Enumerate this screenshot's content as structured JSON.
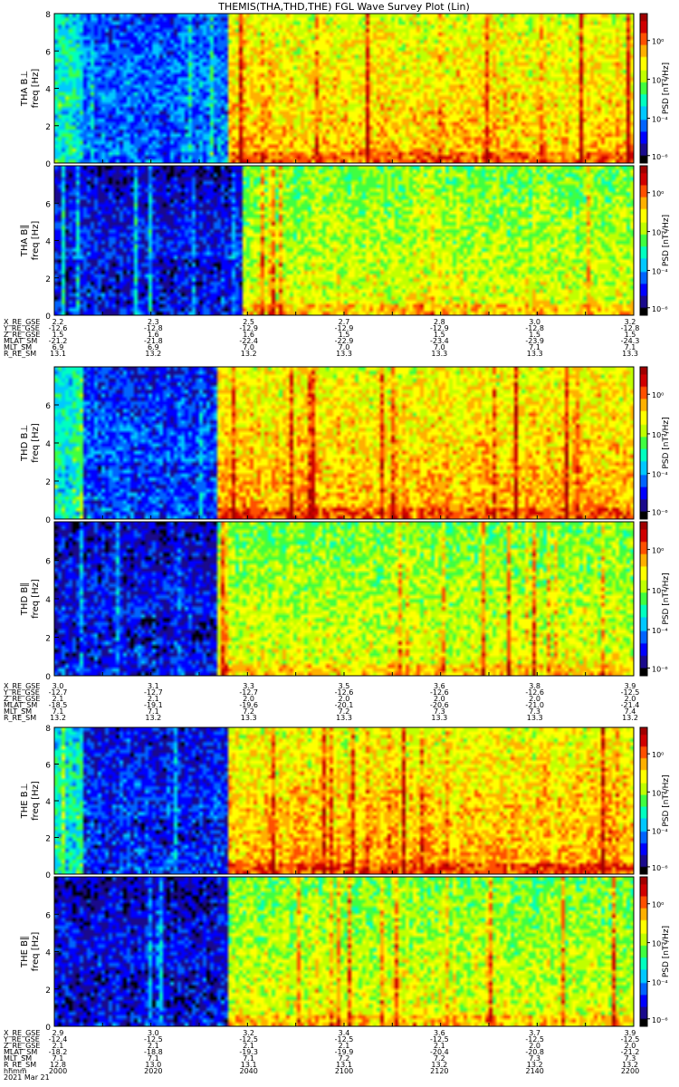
{
  "title": "THEMIS(THA,THD,THE) FGL Wave Survey Plot (Lin)",
  "colors": {
    "colormap": [
      "#000000",
      "#1a0a8c",
      "#0000ff",
      "#0064ff",
      "#00c8ff",
      "#00ffc0",
      "#40ff40",
      "#c0ff00",
      "#ffff00",
      "#ffb000",
      "#ff5000",
      "#d00000",
      "#a00000"
    ]
  },
  "chart_data": [
    {
      "type": "heatmap",
      "panel": "tha-bl",
      "ylabel_probe": "THA B⊥",
      "ylabel_freq": "freq [Hz]",
      "ylim": [
        0,
        8
      ],
      "yticks": [
        "0",
        "2",
        "4",
        "6",
        "8"
      ],
      "zlabel": "PSD [nT²/Hz]",
      "zticks": [
        "10⁰",
        "10⁻²",
        "10⁻⁴",
        "10⁻⁶"
      ],
      "baseline": 0.42,
      "quiet": [
        [
          0.05,
          0.3,
          0.15
        ]
      ],
      "active_level": 0.68,
      "active_from": 0.3
    },
    {
      "type": "heatmap",
      "panel": "tha-bpar",
      "ylabel_probe": "THA B∥",
      "ylabel_freq": "freq [Hz]",
      "ylim": [
        0,
        8
      ],
      "yticks": [
        "0",
        "2",
        "4",
        "6"
      ],
      "zlabel": "PSD [nT²/Hz]",
      "zticks": [
        "10⁰",
        "10⁻²",
        "10⁻⁴",
        "10⁻⁶"
      ],
      "baseline": 0.42,
      "quiet": [
        [
          0.0,
          0.32,
          0.25
        ]
      ],
      "active_level": 0.58,
      "active_from": 0.32
    },
    {
      "type": "heatmap",
      "panel": "thd-bl",
      "ylabel_probe": "THD B⊥",
      "ylabel_freq": "freq [Hz]",
      "ylim": [
        0,
        8
      ],
      "yticks": [
        "0",
        "2",
        "4",
        "6"
      ],
      "zlabel": "PSD [nT²/Hz]",
      "zticks": [
        "10⁰",
        "10⁻²",
        "10⁻⁴",
        "10⁻⁶"
      ],
      "baseline": 0.42,
      "quiet": [
        [
          0.05,
          0.28,
          0.18
        ]
      ],
      "active_level": 0.7,
      "active_from": 0.28
    },
    {
      "type": "heatmap",
      "panel": "thd-bpar",
      "ylabel_probe": "THD B∥",
      "ylabel_freq": "freq [Hz]",
      "ylim": [
        0,
        8
      ],
      "yticks": [
        "0",
        "2",
        "4",
        "6"
      ],
      "zlabel": "PSD [nT²/Hz]",
      "zticks": [
        "10⁰",
        "10⁻²",
        "10⁻⁴",
        "10⁻⁶"
      ],
      "baseline": 0.42,
      "quiet": [
        [
          0.0,
          0.28,
          0.25
        ]
      ],
      "active_level": 0.58,
      "active_from": 0.28
    },
    {
      "type": "heatmap",
      "panel": "the-bl",
      "ylabel_probe": "THE B⊥",
      "ylabel_freq": "freq [Hz]",
      "ylim": [
        0,
        8
      ],
      "yticks": [
        "0",
        "2",
        "4",
        "6",
        "8"
      ],
      "zlabel": "PSD [nT²/Hz]",
      "zticks": [
        "10⁰",
        "10⁻²",
        "10⁻⁴",
        "10⁻⁶"
      ],
      "baseline": 0.42,
      "quiet": [
        [
          0.05,
          0.3,
          0.22
        ]
      ],
      "active_level": 0.7,
      "active_from": 0.3
    },
    {
      "type": "heatmap",
      "panel": "the-bpar",
      "ylabel_probe": "THE B∥",
      "ylabel_freq": "freq [Hz]",
      "ylim": [
        0,
        8
      ],
      "yticks": [
        "0",
        "2",
        "4",
        "6"
      ],
      "zlabel": "PSD [nT²/Hz]",
      "zticks": [
        "10⁰",
        "10⁻²",
        "10⁻⁴",
        "10⁻⁶"
      ],
      "baseline": 0.42,
      "quiet": [
        [
          0.0,
          0.3,
          0.26
        ]
      ],
      "active_level": 0.58,
      "active_from": 0.3
    }
  ],
  "tick_tables": [
    {
      "probe": "tha",
      "labels": [
        "X_RE_GSE",
        "Y_RE_GSE",
        "Z_RE_GSE",
        "MLAT_SM",
        "MLT_SM",
        "R_RE_SM"
      ],
      "rows": [
        [
          "2.2",
          "2.3",
          "2.5",
          "2.7",
          "2.8",
          "3.0",
          "3.2"
        ],
        [
          "-12.6",
          "-12.8",
          "-12.9",
          "-12.9",
          "-12.9",
          "-12.8",
          "-12.8"
        ],
        [
          "1.5",
          "1.6",
          "1.6",
          "1.5",
          "1.5",
          "1.5",
          "1.5"
        ],
        [
          "-21.2",
          "-21.8",
          "-22.4",
          "-22.9",
          "-23.4",
          "-23.9",
          "-24.3"
        ],
        [
          "6.9",
          "6.9",
          "7.0",
          "7.0",
          "7.0",
          "7.1",
          "7.1"
        ],
        [
          "13.1",
          "13.2",
          "13.2",
          "13.3",
          "13.3",
          "13.3",
          "13.3"
        ]
      ]
    },
    {
      "probe": "thd",
      "labels": [
        "X_RE_GSE",
        "Y_RE_GSE",
        "Z_RE_GSE",
        "MLAT_SM",
        "MLT_SM",
        "R_RE_SM"
      ],
      "rows": [
        [
          "3.0",
          "3.1",
          "3.3",
          "3.5",
          "3.6",
          "3.8",
          "3.9"
        ],
        [
          "-12.7",
          "-12.7",
          "-12.7",
          "-12.6",
          "-12.6",
          "-12.6",
          "-12.5"
        ],
        [
          "2.1",
          "2.1",
          "2.0",
          "2.0",
          "2.0",
          "2.0",
          "2.0"
        ],
        [
          "-18.5",
          "-19.1",
          "-19.6",
          "-20.1",
          "-20.6",
          "-21.0",
          "-21.4"
        ],
        [
          "7.1",
          "7.1",
          "7.2",
          "7.2",
          "7.3",
          "7.3",
          "7.4"
        ],
        [
          "13.2",
          "13.2",
          "13.3",
          "13.3",
          "13.3",
          "13.3",
          "13.2"
        ]
      ]
    },
    {
      "probe": "the",
      "labels": [
        "X_RE_GSE",
        "Y_RE_GSE",
        "Z_RE_GSE",
        "MLAT_SM",
        "MLT_SM",
        "R_RE_SM",
        "hhmm",
        "2021 Mar 21"
      ],
      "rows": [
        [
          "2.9",
          "3.0",
          "3.2",
          "3.4",
          "3.6",
          "3.7",
          "3.9"
        ],
        [
          "-12.4",
          "-12.5",
          "-12.5",
          "-12.5",
          "-12.5",
          "-12.5",
          "-12.5"
        ],
        [
          "2.1",
          "2.1",
          "2.1",
          "2.1",
          "2.1",
          "2.0",
          "2.0"
        ],
        [
          "-18.2",
          "-18.8",
          "-19.3",
          "-19.9",
          "-20.4",
          "-20.8",
          "-21.2"
        ],
        [
          "7.1",
          "7.1",
          "7.1",
          "7.2",
          "7.2",
          "7.3",
          "7.3"
        ],
        [
          "12.8",
          "13.0",
          "13.1",
          "13.1",
          "13.2",
          "13.2",
          "13.2"
        ],
        [
          "2000",
          "2020",
          "2040",
          "2100",
          "2120",
          "2140",
          "2200"
        ]
      ]
    }
  ]
}
